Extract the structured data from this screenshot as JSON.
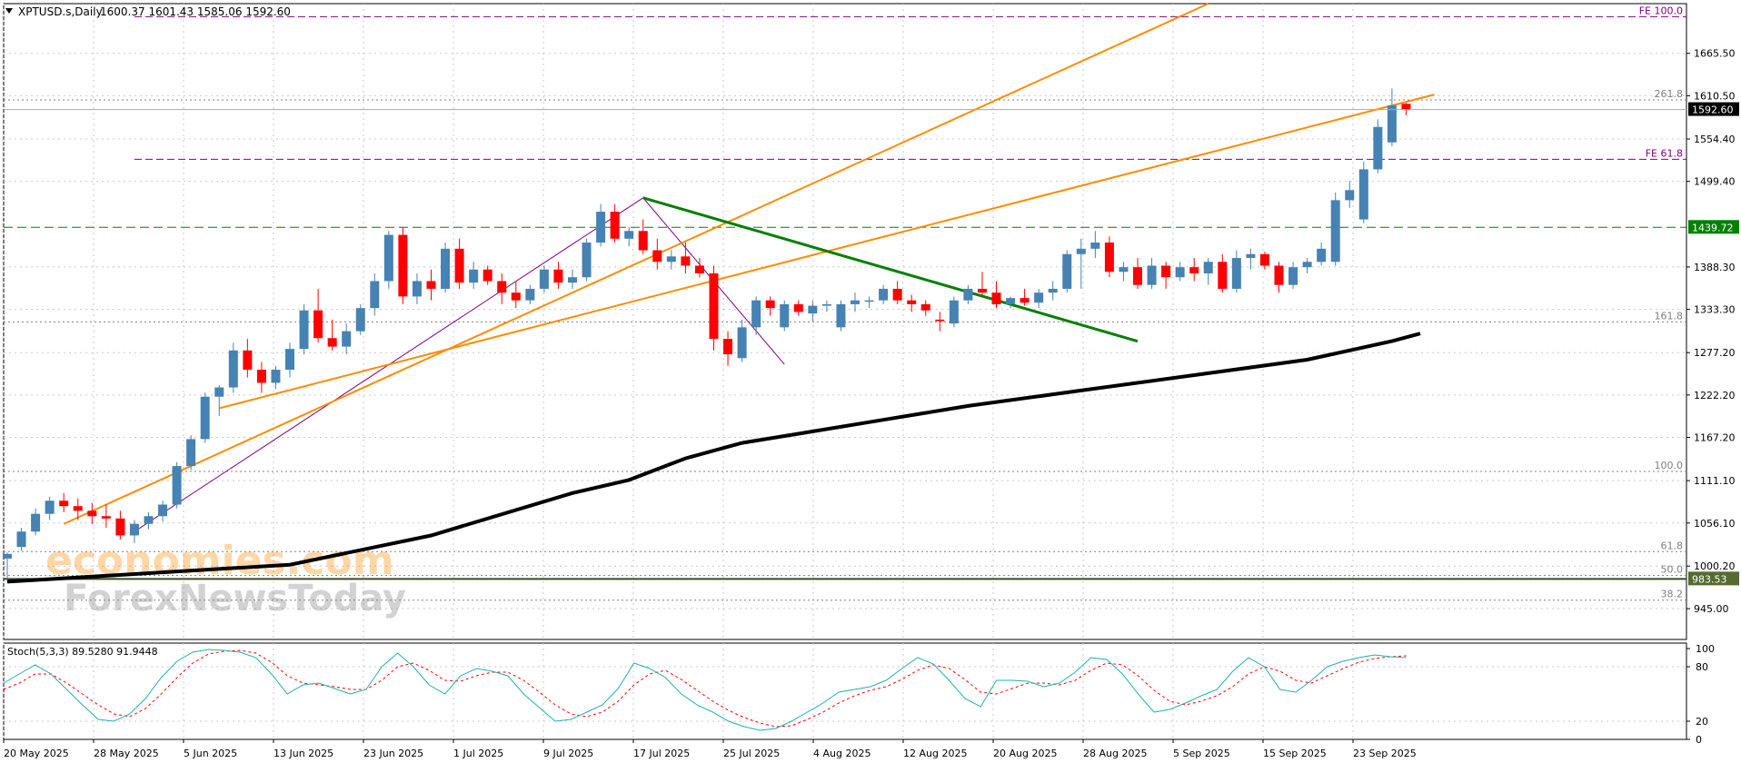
{
  "header": {
    "symbol": "XPTUSD.s,Daily",
    "ohlc": "1600.37 1601.43 1585.06 1592.60"
  },
  "watermark": {
    "line1": "economies.com",
    "line2": "ForexNewsToday"
  },
  "colors": {
    "bull": "#4682b4",
    "bear": "#ff0000",
    "grid": "#c8c8c8",
    "channel": "#ff8c00",
    "trendline": "#008000",
    "ma": "#000000",
    "fib": "#808080",
    "fe": "#800080",
    "stoch_main": "#20b2aa",
    "stoch_signal": "#ff0000",
    "price_tag": "#000000",
    "level_green": "#008000"
  },
  "price_axis": {
    "ticks": [
      "1665.50",
      "1610.50",
      "1554.40",
      "1499.40",
      "1388.30",
      "1333.30",
      "1277.20",
      "1222.20",
      "1167.20",
      "1111.10",
      "1056.10",
      "1000.20",
      "945.00"
    ],
    "current_price": "1592.60"
  },
  "levels": [
    {
      "label": "FE 100.0",
      "value": 1713,
      "kind": "fe"
    },
    {
      "label": "261.8",
      "value": 1605,
      "kind": "fib"
    },
    {
      "label": "FE 61.8",
      "value": 1528,
      "kind": "fe"
    },
    {
      "label": "1439.72",
      "value": 1439.72,
      "kind": "tag"
    },
    {
      "label": "161.8",
      "value": 1317,
      "kind": "fib"
    },
    {
      "label": "100.0",
      "value": 1123,
      "kind": "fib"
    },
    {
      "label": "61.8",
      "value": 1019,
      "kind": "fib"
    },
    {
      "label": "50.0",
      "value": 988,
      "kind": "fib"
    },
    {
      "label": "983.53",
      "value": 983.53,
      "kind": "tag2"
    },
    {
      "label": "38.2",
      "value": 956,
      "kind": "fib"
    }
  ],
  "date_axis": {
    "labels": [
      "20 May 2025",
      "28 May 2025",
      "5 Jun 2025",
      "13 Jun 2025",
      "23 Jun 2025",
      "1 Jul 2025",
      "9 Jul 2025",
      "17 Jul 2025",
      "25 Jul 2025",
      "4 Aug 2025",
      "12 Aug 2025",
      "20 Aug 2025",
      "28 Aug 2025",
      "5 Sep 2025",
      "15 Sep 2025",
      "23 Sep 2025"
    ]
  },
  "stochastic": {
    "label": "Stoch(5,3,3) 89.5280 91.9448",
    "ticks": [
      "100",
      "80",
      "20",
      "0"
    ],
    "main": [
      62,
      72,
      82,
      72,
      55,
      38,
      22,
      20,
      28,
      45,
      68,
      86,
      96,
      99,
      98,
      96,
      90,
      72,
      50,
      60,
      62,
      56,
      50,
      55,
      80,
      95,
      80,
      60,
      50,
      70,
      78,
      75,
      70,
      50,
      35,
      20,
      22,
      30,
      38,
      56,
      84,
      78,
      68,
      50,
      38,
      30,
      20,
      14,
      10,
      12,
      20,
      30,
      40,
      52,
      55,
      58,
      65,
      78,
      90,
      83,
      65,
      45,
      36,
      65,
      65,
      64,
      58,
      62,
      74,
      90,
      88,
      72,
      50,
      30,
      33,
      40,
      48,
      55,
      75,
      90,
      80,
      55,
      52,
      65,
      80,
      86,
      90,
      93,
      91,
      90
    ],
    "signal": [
      55,
      62,
      72,
      72,
      62,
      50,
      38,
      28,
      25,
      34,
      50,
      68,
      84,
      94,
      97,
      98,
      95,
      85,
      70,
      62,
      60,
      58,
      55,
      55,
      65,
      80,
      84,
      76,
      65,
      64,
      70,
      74,
      74,
      65,
      52,
      38,
      28,
      25,
      30,
      42,
      60,
      72,
      76,
      66,
      54,
      42,
      32,
      24,
      18,
      14,
      15,
      22,
      30,
      40,
      48,
      54,
      58,
      66,
      76,
      82,
      78,
      66,
      52,
      50,
      56,
      62,
      62,
      60,
      65,
      76,
      84,
      82,
      70,
      54,
      42,
      38,
      42,
      48,
      58,
      72,
      80,
      75,
      65,
      62,
      70,
      78,
      85,
      89,
      91,
      92
    ]
  },
  "chart_data": {
    "type": "candlestick",
    "title": "XPTUSD.s,Daily",
    "ohlc_header": [
      1600.37,
      1601.43,
      1585.06,
      1592.6
    ],
    "ylim": [
      905,
      1730
    ],
    "candles": [
      [
        1010,
        1018,
        985,
        1016
      ],
      [
        1025,
        1050,
        1020,
        1045
      ],
      [
        1045,
        1075,
        1040,
        1068
      ],
      [
        1068,
        1090,
        1060,
        1085
      ],
      [
        1085,
        1095,
        1070,
        1078
      ],
      [
        1078,
        1088,
        1060,
        1072
      ],
      [
        1072,
        1082,
        1055,
        1065
      ],
      [
        1065,
        1080,
        1050,
        1062
      ],
      [
        1062,
        1072,
        1035,
        1040
      ],
      [
        1040,
        1060,
        1030,
        1055
      ],
      [
        1055,
        1070,
        1048,
        1065
      ],
      [
        1065,
        1085,
        1058,
        1080
      ],
      [
        1080,
        1135,
        1075,
        1130
      ],
      [
        1130,
        1170,
        1125,
        1165
      ],
      [
        1165,
        1225,
        1160,
        1220
      ],
      [
        1220,
        1235,
        1195,
        1232
      ],
      [
        1232,
        1290,
        1225,
        1280
      ],
      [
        1280,
        1295,
        1245,
        1255
      ],
      [
        1255,
        1265,
        1225,
        1238
      ],
      [
        1238,
        1260,
        1230,
        1255
      ],
      [
        1255,
        1290,
        1245,
        1282
      ],
      [
        1282,
        1340,
        1275,
        1332
      ],
      [
        1332,
        1360,
        1290,
        1296
      ],
      [
        1296,
        1320,
        1280,
        1285
      ],
      [
        1285,
        1315,
        1275,
        1305
      ],
      [
        1305,
        1340,
        1300,
        1335
      ],
      [
        1335,
        1380,
        1325,
        1370
      ],
      [
        1370,
        1435,
        1360,
        1430
      ],
      [
        1430,
        1440,
        1340,
        1350
      ],
      [
        1350,
        1380,
        1340,
        1370
      ],
      [
        1370,
        1385,
        1345,
        1360
      ],
      [
        1360,
        1420,
        1355,
        1412
      ],
      [
        1412,
        1425,
        1360,
        1368
      ],
      [
        1368,
        1395,
        1360,
        1385
      ],
      [
        1385,
        1390,
        1365,
        1370
      ],
      [
        1370,
        1380,
        1340,
        1355
      ],
      [
        1355,
        1370,
        1335,
        1345
      ],
      [
        1345,
        1365,
        1340,
        1360
      ],
      [
        1360,
        1390,
        1355,
        1385
      ],
      [
        1385,
        1395,
        1360,
        1368
      ],
      [
        1368,
        1385,
        1360,
        1375
      ],
      [
        1375,
        1425,
        1370,
        1420
      ],
      [
        1420,
        1470,
        1415,
        1460
      ],
      [
        1460,
        1470,
        1420,
        1425
      ],
      [
        1425,
        1440,
        1415,
        1435
      ],
      [
        1435,
        1450,
        1405,
        1410
      ],
      [
        1410,
        1425,
        1385,
        1395
      ],
      [
        1395,
        1410,
        1385,
        1402
      ],
      [
        1402,
        1420,
        1380,
        1390
      ],
      [
        1390,
        1400,
        1375,
        1380
      ],
      [
        1380,
        1390,
        1280,
        1295
      ],
      [
        1295,
        1305,
        1260,
        1275
      ],
      [
        1270,
        1320,
        1265,
        1310
      ],
      [
        1310,
        1350,
        1300,
        1345
      ],
      [
        1345,
        1350,
        1325,
        1335
      ],
      [
        1310,
        1345,
        1305,
        1340
      ],
      [
        1340,
        1345,
        1325,
        1330
      ],
      [
        1328,
        1345,
        1318,
        1338
      ],
      [
        1338,
        1345,
        1330,
        1340
      ],
      [
        1310,
        1345,
        1305,
        1340
      ],
      [
        1340,
        1355,
        1330,
        1345
      ],
      [
        1345,
        1350,
        1335,
        1345
      ],
      [
        1345,
        1365,
        1340,
        1360
      ],
      [
        1360,
        1370,
        1340,
        1345
      ],
      [
        1345,
        1352,
        1330,
        1340
      ],
      [
        1340,
        1345,
        1325,
        1332
      ],
      [
        1320,
        1330,
        1305,
        1318
      ],
      [
        1315,
        1350,
        1310,
        1345
      ],
      [
        1345,
        1365,
        1340,
        1360
      ],
      [
        1360,
        1382,
        1350,
        1355
      ],
      [
        1355,
        1370,
        1335,
        1340
      ],
      [
        1340,
        1350,
        1335,
        1348
      ],
      [
        1348,
        1360,
        1338,
        1342
      ],
      [
        1342,
        1360,
        1335,
        1355
      ],
      [
        1355,
        1370,
        1345,
        1360
      ],
      [
        1360,
        1410,
        1355,
        1405
      ],
      [
        1405,
        1425,
        1360,
        1412
      ],
      [
        1412,
        1435,
        1400,
        1420
      ],
      [
        1420,
        1428,
        1375,
        1382
      ],
      [
        1382,
        1395,
        1370,
        1388
      ],
      [
        1388,
        1400,
        1360,
        1365
      ],
      [
        1365,
        1400,
        1360,
        1390
      ],
      [
        1390,
        1395,
        1360,
        1375
      ],
      [
        1375,
        1395,
        1370,
        1388
      ],
      [
        1388,
        1400,
        1370,
        1380
      ],
      [
        1380,
        1400,
        1365,
        1395
      ],
      [
        1395,
        1405,
        1355,
        1360
      ],
      [
        1360,
        1410,
        1355,
        1400
      ],
      [
        1400,
        1412,
        1385,
        1405
      ],
      [
        1405,
        1408,
        1385,
        1390
      ],
      [
        1390,
        1395,
        1355,
        1365
      ],
      [
        1365,
        1395,
        1360,
        1388
      ],
      [
        1388,
        1400,
        1380,
        1395
      ],
      [
        1395,
        1420,
        1390,
        1412
      ],
      [
        1395,
        1485,
        1390,
        1475
      ],
      [
        1475,
        1500,
        1465,
        1488
      ],
      [
        1450,
        1525,
        1445,
        1515
      ],
      [
        1515,
        1580,
        1510,
        1570
      ],
      [
        1550,
        1620,
        1545,
        1598
      ],
      [
        1600,
        1601,
        1585,
        1593
      ]
    ],
    "moving_average": [
      {
        "t": 0,
        "v": 980
      },
      {
        "t": 20,
        "v": 1002
      },
      {
        "t": 30,
        "v": 1040
      },
      {
        "t": 40,
        "v": 1095
      },
      {
        "t": 44,
        "v": 1112
      },
      {
        "t": 48,
        "v": 1140
      },
      {
        "t": 52,
        "v": 1160
      },
      {
        "t": 56,
        "v": 1172
      },
      {
        "t": 62,
        "v": 1190
      },
      {
        "t": 68,
        "v": 1208
      },
      {
        "t": 76,
        "v": 1228
      },
      {
        "t": 84,
        "v": 1248
      },
      {
        "t": 92,
        "v": 1268
      },
      {
        "t": 98,
        "v": 1292
      },
      {
        "t": 100,
        "v": 1302
      }
    ],
    "channel": [
      {
        "from": [
          4,
          1055
        ],
        "to": [
          85,
          1730
        ]
      },
      {
        "from": [
          15,
          1205
        ],
        "to": [
          101,
          1612
        ]
      }
    ],
    "trendline": {
      "from": [
        45,
        1478
      ],
      "to": [
        80,
        1292
      ]
    },
    "zigzag": [
      [
        9,
        1045
      ],
      [
        45,
        1478
      ],
      [
        55,
        1262
      ]
    ]
  }
}
